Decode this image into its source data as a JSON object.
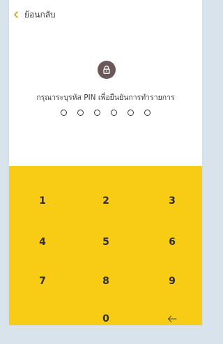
{
  "header": {
    "back_label": "ย้อนกลับ",
    "back_icon": "chevron-left-icon"
  },
  "pin": {
    "lock_icon": "lock-icon",
    "instruction": "กรุณาระบุรหัส PIN เพื่อยืนยันการทำรายการ",
    "length": 6,
    "entered": 0
  },
  "keypad": {
    "keys": [
      "1",
      "2",
      "3",
      "4",
      "5",
      "6",
      "7",
      "8",
      "9",
      "",
      "0",
      "←"
    ],
    "backspace_icon": "backspace-arrow-icon"
  },
  "colors": {
    "keypad_background": "#f8cb14",
    "page_background": "#d8e3eb",
    "lock_background": "#6a5958"
  }
}
